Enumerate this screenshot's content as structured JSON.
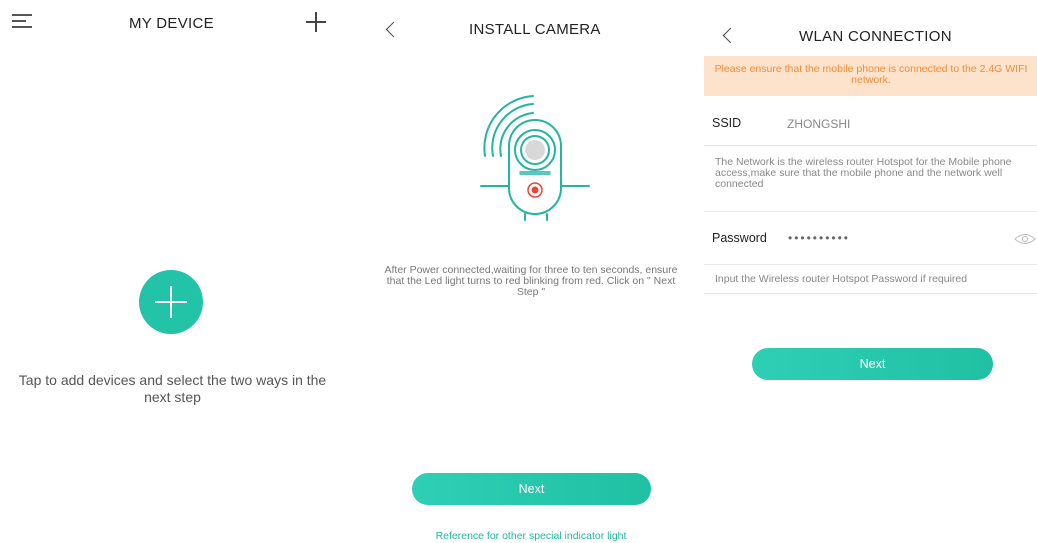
{
  "panel1": {
    "title": "MY DEVICE",
    "hint": "Tap to add devices and select the two ways in the next step"
  },
  "panel2": {
    "title": "INSTALL CAMERA",
    "description": "After Power connected,waiting for three to ten seconds, ensure that the Led light turns to red blinking from red. Click on \" Next Step \"",
    "next_label": "Next",
    "reference_link": "Reference for other special indicator light"
  },
  "panel3": {
    "title": "WLAN CONNECTION",
    "warning": "Please ensure that the mobile phone is connected to the 2.4G WIFI network.",
    "ssid_label": "SSID",
    "ssid_value": "ZHONGSHI",
    "ssid_note": "The Network is the wireless router Hotspot for the Mobile phone access,make sure that the mobile phone and the network well connected",
    "password_label": "Password",
    "password_value": "••••••••••",
    "password_note": "Input the Wireless router Hotspot Password if required",
    "next_label": "Next"
  },
  "colors": {
    "accent": "#23c3a8",
    "warning_bg": "#fde3cc",
    "warning_text": "#f28c38",
    "led_red": "#e8443a"
  },
  "icons": {
    "menu": "menu-icon",
    "add": "plus-icon",
    "back": "chevron-left-icon",
    "eye": "eye-icon",
    "camera": "camera-illustration"
  }
}
